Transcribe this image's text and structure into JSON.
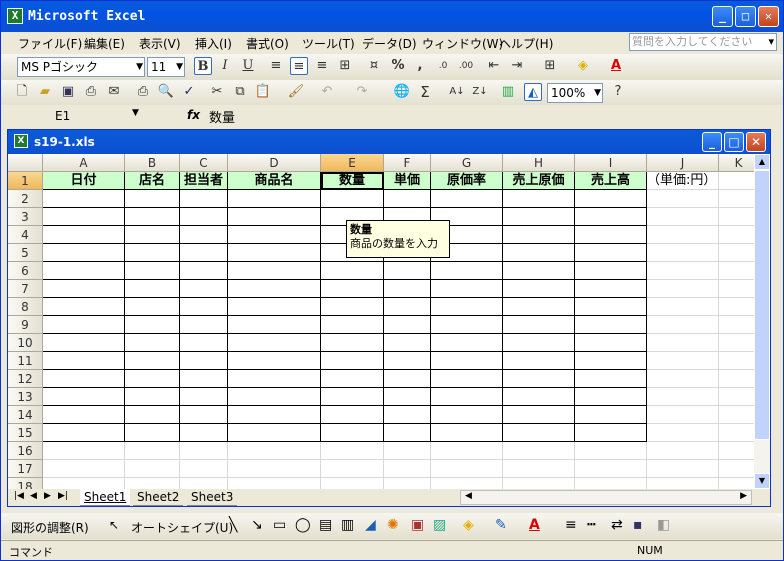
{
  "app": {
    "title": "Microsoft Excel"
  },
  "menu": [
    "ファイル(F)",
    "編集(E)",
    "表示(V)",
    "挿入(I)",
    "書式(O)",
    "ツール(T)",
    "データ(D)",
    "ウィンドウ(W)",
    "ヘルプ(H)"
  ],
  "help_placeholder": "質問を入力してください",
  "format_toolbar": {
    "font": "MS Pゴシック",
    "size": "11",
    "bold": "B",
    "italic": "I",
    "underline": "U",
    "percent": "%",
    "comma": ","
  },
  "standard_toolbar": {
    "zoom": "100%",
    "sigma": "Σ"
  },
  "formula_bar": {
    "name_box": "E1",
    "fx": "fx",
    "content": "数量"
  },
  "workbook": {
    "title": "s19-1.xls"
  },
  "columns": [
    "A",
    "B",
    "C",
    "D",
    "E",
    "F",
    "G",
    "H",
    "I",
    "J",
    "K"
  ],
  "rows": [
    "1",
    "2",
    "3",
    "4",
    "5",
    "6",
    "7",
    "8",
    "9",
    "10",
    "11",
    "12",
    "13",
    "14",
    "15",
    "16",
    "17",
    "18"
  ],
  "header_cells": [
    "日付",
    "店名",
    "担当者",
    "商品名",
    "数量",
    "単価",
    "原価率",
    "売上原価",
    "売上高"
  ],
  "note_cell": "（単価:円）",
  "tooltip": {
    "title": "数量",
    "body": "商品の数量を入力"
  },
  "sheets": [
    "Sheet1",
    "Sheet2",
    "Sheet3"
  ],
  "drawing_toolbar": {
    "draw": "図形の調整(R)",
    "autoshape": "オートシェイプ(U)"
  },
  "status": {
    "left": "コマンド",
    "right": "NUM"
  },
  "colors": {
    "header_fill": "#ccffcc",
    "title_bar": "#0054e3",
    "tooltip": "#ffffe1"
  }
}
